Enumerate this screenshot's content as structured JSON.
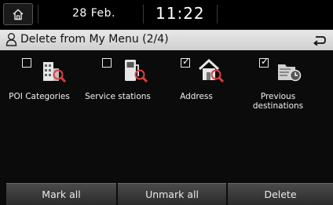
{
  "statusbar": {
    "date": "28 Feb.",
    "time": "11:22"
  },
  "header": {
    "title": "Delete from My Menu (2/4)"
  },
  "items": [
    {
      "label": "POI Categories",
      "checked": false,
      "icon": "poi-categories-icon"
    },
    {
      "label": "Service stations",
      "checked": false,
      "icon": "fuel-pump-icon"
    },
    {
      "label": "Address",
      "checked": true,
      "icon": "house-search-icon"
    },
    {
      "label_line1": "Previous",
      "label_line2": "destinations",
      "checked": true,
      "icon": "folder-clock-icon"
    }
  ],
  "checkmark_glyph": "✓",
  "buttons": {
    "mark_all": "Mark all",
    "unmark_all": "Unmark all",
    "delete": "Delete"
  }
}
